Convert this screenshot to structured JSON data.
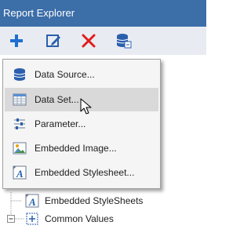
{
  "window": {
    "title": "Report Explorer"
  },
  "toolbar": {
    "buttons": [
      {
        "name": "add",
        "icon": "plus-icon",
        "color": "#1f6fd1"
      },
      {
        "name": "edit",
        "icon": "edit-icon",
        "color": "#2b5fae"
      },
      {
        "name": "delete",
        "icon": "delete-x-icon",
        "color": "#e11d1d"
      },
      {
        "name": "data-source",
        "icon": "database-icon",
        "color": "#2b5fae"
      }
    ]
  },
  "context_menu": {
    "items": [
      {
        "label": "Data Source...",
        "icon": "database-icon"
      },
      {
        "label": "Data Set...",
        "icon": "dataset-table-icon",
        "hovered": true
      },
      {
        "label": "Parameter...",
        "icon": "parameter-icon"
      },
      {
        "label": "Embedded Image...",
        "icon": "image-icon"
      },
      {
        "label": "Embedded Stylesheet...",
        "icon": "stylesheet-icon"
      }
    ]
  },
  "tree": {
    "items": [
      {
        "label": "Embedded StyleSheets",
        "icon": "stylesheet-icon"
      },
      {
        "label": "Common Values",
        "icon": "common-values-icon",
        "expander": "collapsed"
      }
    ]
  },
  "colors": {
    "titlebar": "#3c6ea8",
    "toolbar": "#e8ecf2",
    "menu_hover": "#d9d9d9"
  }
}
